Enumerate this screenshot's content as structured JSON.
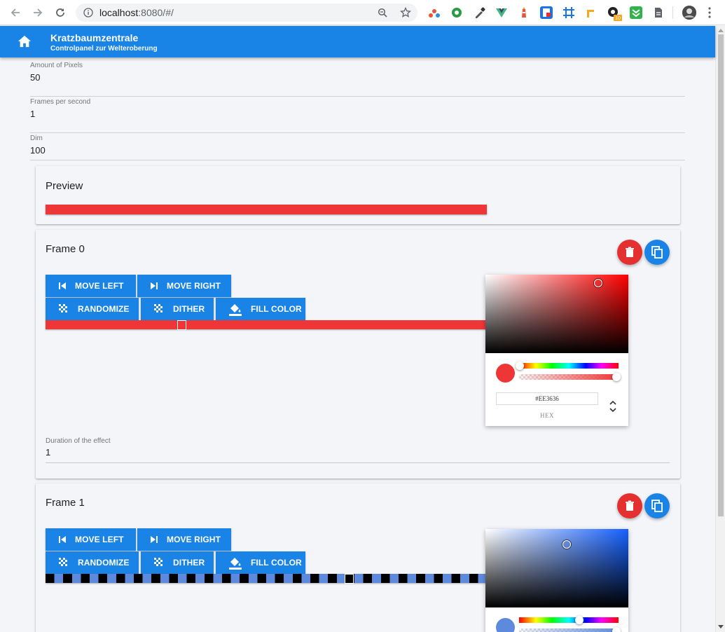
{
  "browser": {
    "url_host": "localhost",
    "url_rest": ":8080/#/"
  },
  "app": {
    "title": "Kratzbaumzentrale",
    "subtitle": "Controlpanel zur Welteroberung"
  },
  "fields": [
    {
      "label": "Amount of Pixels",
      "value": "50"
    },
    {
      "label": "Frames per second",
      "value": "1"
    },
    {
      "label": "Dim",
      "value": "100"
    }
  ],
  "preview": {
    "title": "Preview",
    "color": "#EE3636"
  },
  "buttons": {
    "move_left": "MOVE LEFT",
    "move_right": "MOVE RIGHT",
    "randomize": "RANDOMIZE",
    "dither": "DITHER",
    "fill_color": "FILL COLOR"
  },
  "frames": [
    {
      "title": "Frame 0",
      "color": "#EE3636",
      "picker_hex": "#EE3636",
      "picker_mode": "HEX",
      "duration_label": "Duration of the effect",
      "duration_value": "1"
    },
    {
      "title": "Frame 1",
      "color": "#5E8ADE"
    }
  ],
  "colors": {
    "primary": "#1A84E6",
    "danger": "#E43030",
    "frame0": "#EE3636",
    "frame1_blue": "#5E8ADE",
    "frame1_black": "#000000"
  },
  "icons": {
    "home": "home-icon",
    "delete": "trash-icon",
    "copy": "copy-icon",
    "move_left": "skip-previous-icon",
    "move_right": "skip-next-icon",
    "randomize": "checkerboard-icon",
    "dither": "checkerboard-icon",
    "fill": "fill-bucket-icon"
  }
}
